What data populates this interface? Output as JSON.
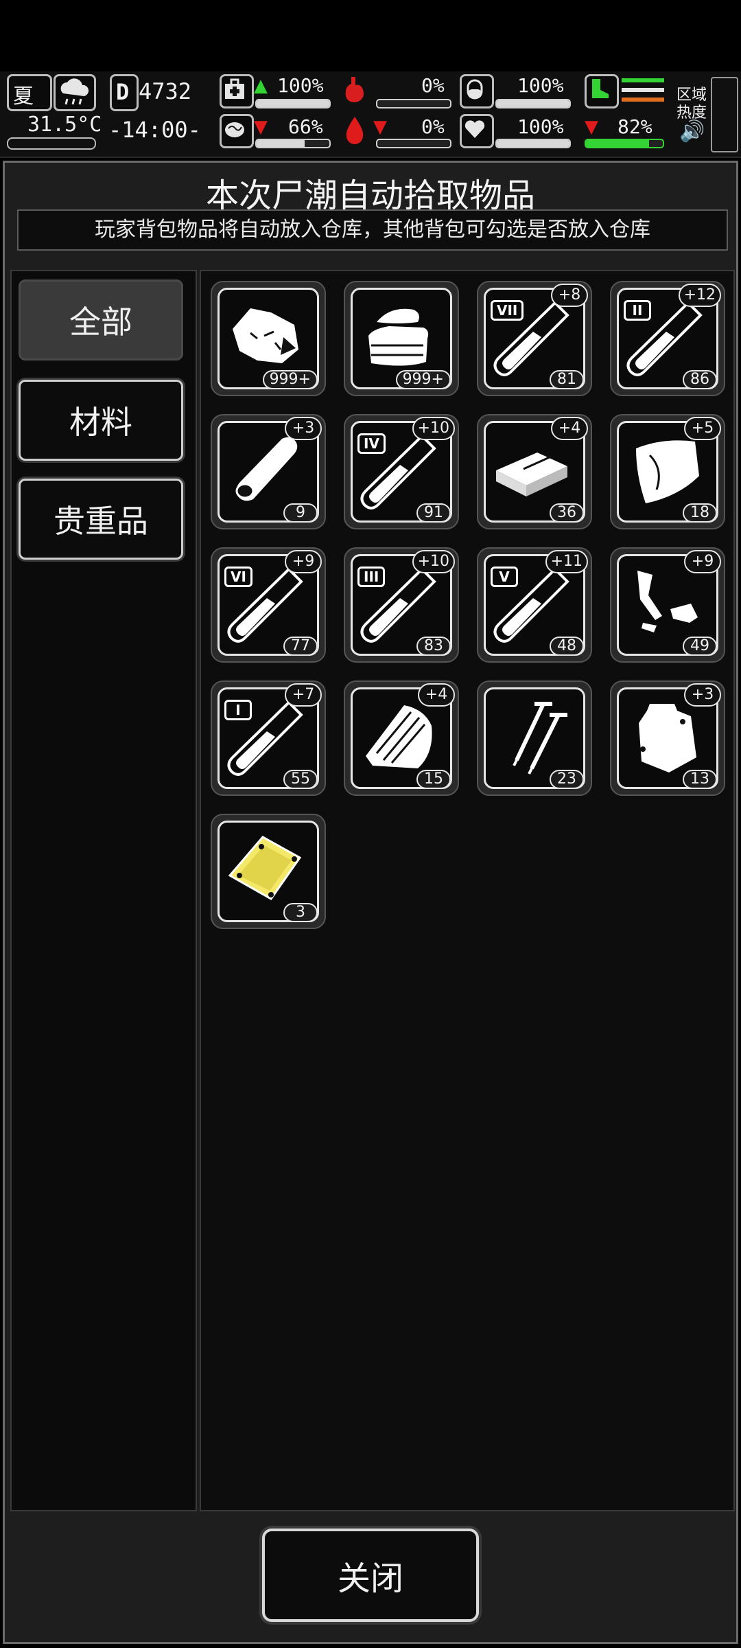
{
  "hud": {
    "season": "夏",
    "temperature": "31.5°C",
    "day_counter": "4732",
    "day_prefix": "D",
    "clock": "-14:00-",
    "stats": [
      {
        "value": "100%",
        "trend": "up",
        "icon": "medkit-icon",
        "level": 1.0
      },
      {
        "value": "66%",
        "trend": "down",
        "icon": "brain-icon",
        "level": 0.66
      },
      {
        "value": "0%",
        "trend": "",
        "icon": "stomach-icon",
        "level": 0.0
      },
      {
        "value": "0%",
        "trend": "down",
        "icon": "blood-drop-icon",
        "level": 0.0
      },
      {
        "value": "100%",
        "trend": "",
        "icon": "capsule-icon",
        "level": 1.0
      },
      {
        "value": "100%",
        "trend": "",
        "icon": "heart-icon",
        "level": 1.0
      },
      {
        "value": "82%",
        "trend": "down",
        "icon": "boot-icon",
        "level": 0.82
      }
    ],
    "zone_heat_label_1": "区域",
    "zone_heat_label_2": "热度"
  },
  "dialog": {
    "title": "本次尸潮自动拾取物品",
    "subtitle": "玩家背包物品将自动放入仓库，其他背包可勾选是否放入仓库"
  },
  "categories": [
    {
      "label": "全部",
      "active": true
    },
    {
      "label": "材料",
      "active": false
    },
    {
      "label": "贵重品",
      "active": false
    }
  ],
  "items": [
    {
      "icon": "cloth-scraps-icon",
      "count": "999+",
      "plus": ""
    },
    {
      "icon": "folded-cloth-icon",
      "count": "999+",
      "plus": ""
    },
    {
      "icon": "test-tube-icon",
      "roman": "VII",
      "count": "81",
      "plus": "+8"
    },
    {
      "icon": "test-tube-icon",
      "roman": "II",
      "count": "86",
      "plus": "+12"
    },
    {
      "icon": "wood-log-icon",
      "count": "9",
      "plus": "+3"
    },
    {
      "icon": "test-tube-icon",
      "roman": "IV",
      "count": "91",
      "plus": "+10"
    },
    {
      "icon": "ingot-bar-icon",
      "count": "36",
      "plus": "+4"
    },
    {
      "icon": "plastic-sheet-icon",
      "count": "18",
      "plus": "+5"
    },
    {
      "icon": "test-tube-icon",
      "roman": "VI",
      "count": "77",
      "plus": "+9"
    },
    {
      "icon": "test-tube-icon",
      "roman": "III",
      "count": "83",
      "plus": "+10"
    },
    {
      "icon": "test-tube-icon",
      "roman": "V",
      "count": "48",
      "plus": "+11"
    },
    {
      "icon": "scrap-parts-icon",
      "count": "49",
      "plus": "+9"
    },
    {
      "icon": "test-tube-icon",
      "roman": "I",
      "count": "55",
      "plus": "+7"
    },
    {
      "icon": "wood-planks-icon",
      "count": "15",
      "plus": "+4"
    },
    {
      "icon": "nails-icon",
      "count": "23",
      "plus": ""
    },
    {
      "icon": "plastic-bag-icon",
      "count": "13",
      "plus": "+3"
    },
    {
      "icon": "gold-plate-icon",
      "count": "3",
      "plus": ""
    }
  ],
  "footer": {
    "close_label": "关闭"
  }
}
